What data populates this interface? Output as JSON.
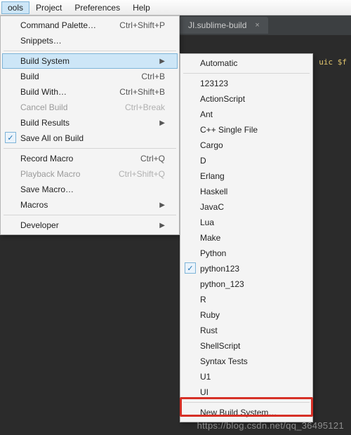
{
  "menubar": {
    "items": [
      {
        "label": "ools",
        "active": true
      },
      {
        "label": "Project"
      },
      {
        "label": "Preferences"
      },
      {
        "label": "Help"
      }
    ]
  },
  "tab": {
    "title": "JI.sublime-build",
    "close": "×"
  },
  "editor_snippet": "uic $f",
  "tools_menu": [
    {
      "type": "item",
      "label": "Command Palette…",
      "shortcut": "Ctrl+Shift+P"
    },
    {
      "type": "item",
      "label": "Snippets…"
    },
    {
      "type": "sep"
    },
    {
      "type": "item",
      "label": "Build System",
      "arrow": true,
      "hover": true
    },
    {
      "type": "item",
      "label": "Build",
      "shortcut": "Ctrl+B"
    },
    {
      "type": "item",
      "label": "Build With…",
      "shortcut": "Ctrl+Shift+B"
    },
    {
      "type": "item",
      "label": "Cancel Build",
      "shortcut": "Ctrl+Break",
      "disabled": true
    },
    {
      "type": "item",
      "label": "Build Results",
      "arrow": true
    },
    {
      "type": "item",
      "label": "Save All on Build",
      "checked": true
    },
    {
      "type": "sep"
    },
    {
      "type": "item",
      "label": "Record Macro",
      "shortcut": "Ctrl+Q"
    },
    {
      "type": "item",
      "label": "Playback Macro",
      "shortcut": "Ctrl+Shift+Q",
      "disabled": true
    },
    {
      "type": "item",
      "label": "Save Macro…"
    },
    {
      "type": "item",
      "label": "Macros",
      "arrow": true
    },
    {
      "type": "sep"
    },
    {
      "type": "item",
      "label": "Developer",
      "arrow": true
    }
  ],
  "build_submenu": [
    {
      "type": "item",
      "label": "Automatic"
    },
    {
      "type": "sep"
    },
    {
      "type": "item",
      "label": "123123"
    },
    {
      "type": "item",
      "label": "ActionScript"
    },
    {
      "type": "item",
      "label": "Ant"
    },
    {
      "type": "item",
      "label": "C++ Single File"
    },
    {
      "type": "item",
      "label": "Cargo"
    },
    {
      "type": "item",
      "label": "D"
    },
    {
      "type": "item",
      "label": "Erlang"
    },
    {
      "type": "item",
      "label": "Haskell"
    },
    {
      "type": "item",
      "label": "JavaC"
    },
    {
      "type": "item",
      "label": "Lua"
    },
    {
      "type": "item",
      "label": "Make"
    },
    {
      "type": "item",
      "label": "Python"
    },
    {
      "type": "item",
      "label": "python123",
      "checked": true
    },
    {
      "type": "item",
      "label": "python_123"
    },
    {
      "type": "item",
      "label": "R"
    },
    {
      "type": "item",
      "label": "Ruby"
    },
    {
      "type": "item",
      "label": "Rust"
    },
    {
      "type": "item",
      "label": "ShellScript"
    },
    {
      "type": "item",
      "label": "Syntax Tests"
    },
    {
      "type": "item",
      "label": "U1"
    },
    {
      "type": "item",
      "label": "UI"
    },
    {
      "type": "sep"
    },
    {
      "type": "item",
      "label": "New Build System…"
    }
  ],
  "watermark": "https://blog.csdn.net/qq_36495121"
}
